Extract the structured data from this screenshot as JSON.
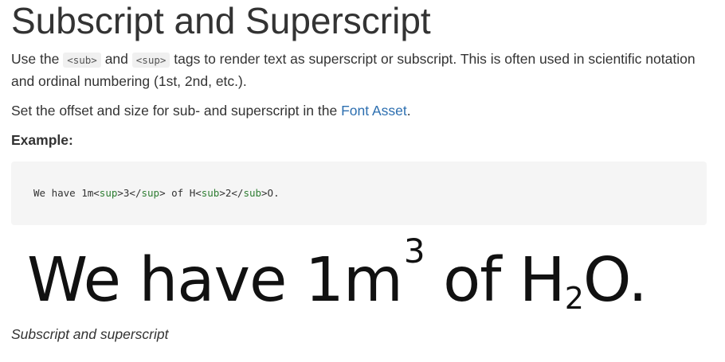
{
  "title": "Subscript and Superscript",
  "intro": {
    "use_the": "Use the ",
    "sub_tag": "<sub>",
    "and": " and ",
    "sup_tag": "<sup>",
    "rest": " tags to render text as superscript or subscript. This is often used in scientific notation and ordinal numbering (1st, 2nd, etc.)."
  },
  "offset": {
    "text_before": "Set the offset and size for sub- and superscript in the ",
    "link": "Font Asset",
    "text_after": "."
  },
  "example_label": "Example:",
  "code": {
    "part1": "We have 1m<",
    "sup_open": "sup",
    "part2": ">3</",
    "sup_close": "sup",
    "part3": "> of H<",
    "sub_open": "sub",
    "part4": ">2</",
    "sub_close": "sub",
    "part5": ">O."
  },
  "rendered": {
    "prefix": "We have 1m",
    "sup": "3",
    "middle": " of H",
    "sub": "2",
    "suffix": "O."
  },
  "caption": "Subscript and superscript",
  "colors": {
    "link": "#2d6fb0",
    "tag": "#2e7d32",
    "code_bg": "#f5f5f5"
  }
}
